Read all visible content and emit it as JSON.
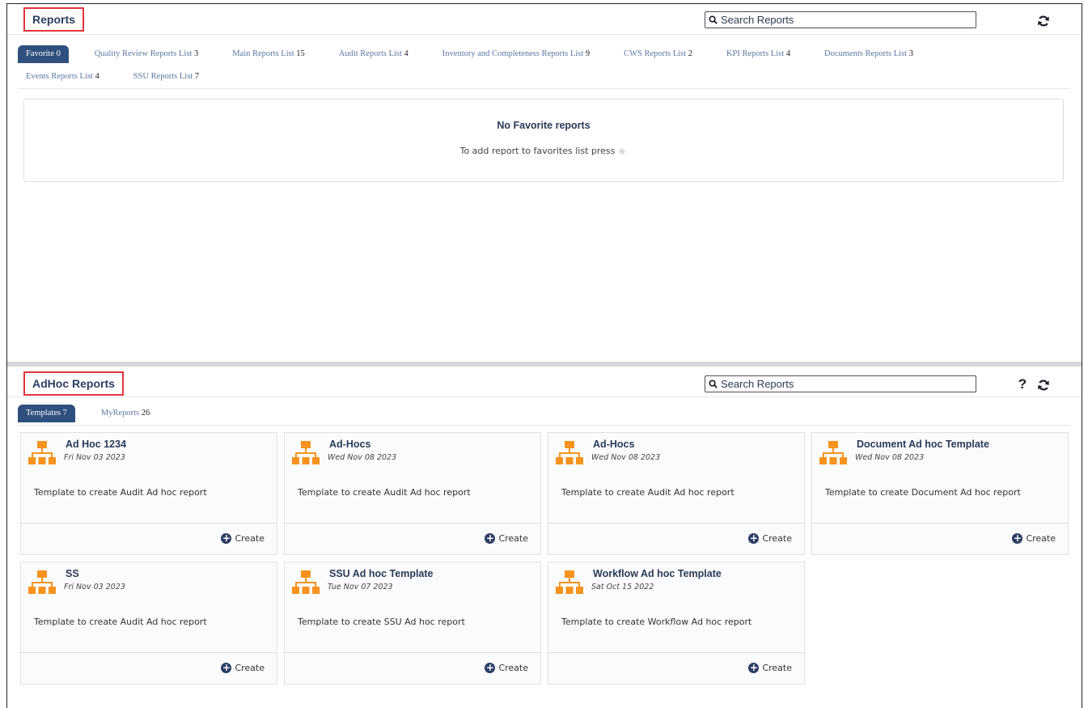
{
  "reports": {
    "title": "Reports",
    "search_placeholder": "Search Reports",
    "tabs_row1": [
      {
        "label": "Favorite",
        "count": "0"
      },
      {
        "label": "Quality Review Reports List",
        "count": "3"
      },
      {
        "label": "Main Reports List",
        "count": "15"
      },
      {
        "label": "Audit Reports List",
        "count": "4"
      },
      {
        "label": "Inventory and Completeness Reports List",
        "count": "9"
      },
      {
        "label": "CWS Reports List",
        "count": "2"
      },
      {
        "label": "KPI Reports List",
        "count": "4"
      },
      {
        "label": "Documents Reports List",
        "count": "3"
      }
    ],
    "tabs_row2": [
      {
        "label": "Events Reports List",
        "count": "4"
      },
      {
        "label": "SSU Reports List",
        "count": "7"
      }
    ],
    "empty_title": "No Favorite reports",
    "empty_hint": "To add report to favorites list press"
  },
  "adhoc": {
    "title": "AdHoc Reports",
    "search_placeholder": "Search Reports",
    "help_symbol": "?",
    "tabs": [
      {
        "label": "Templates",
        "count": "7"
      },
      {
        "label": "MyReports",
        "count": "26"
      }
    ],
    "create_label": "Create",
    "cards": [
      {
        "title": "Ad Hoc 1234",
        "date": "Fri Nov 03 2023",
        "desc": "Template to create Audit Ad hoc report"
      },
      {
        "title": "Ad-Hocs",
        "date": "Wed Nov 08 2023",
        "desc": "Template to create Audit Ad hoc report"
      },
      {
        "title": "Ad-Hocs",
        "date": "Wed Nov 08 2023",
        "desc": "Template to create Audit Ad hoc report"
      },
      {
        "title": "Document Ad hoc Template",
        "date": "Wed Nov 08 2023",
        "desc": "Template to create Document Ad hoc report"
      },
      {
        "title": "SS",
        "date": "Fri Nov 03 2023",
        "desc": "Template to create Audit Ad hoc report"
      },
      {
        "title": "SSU Ad hoc Template",
        "date": "Tue Nov 07 2023",
        "desc": "Template to create SSU Ad hoc report"
      },
      {
        "title": "Workflow Ad hoc Template",
        "date": "Sat Oct 15 2022",
        "desc": "Template to create Workflow Ad hoc report"
      }
    ]
  },
  "colors": {
    "accent": "#2f4f7e",
    "icon_orange": "#f7931e",
    "highlight_red": "#e4343a"
  },
  "icons": {
    "search": "search-icon",
    "refresh": "refresh-icon",
    "help": "help-icon",
    "star": "star-icon",
    "template": "org-chart-icon",
    "create": "plus-circle-icon"
  }
}
